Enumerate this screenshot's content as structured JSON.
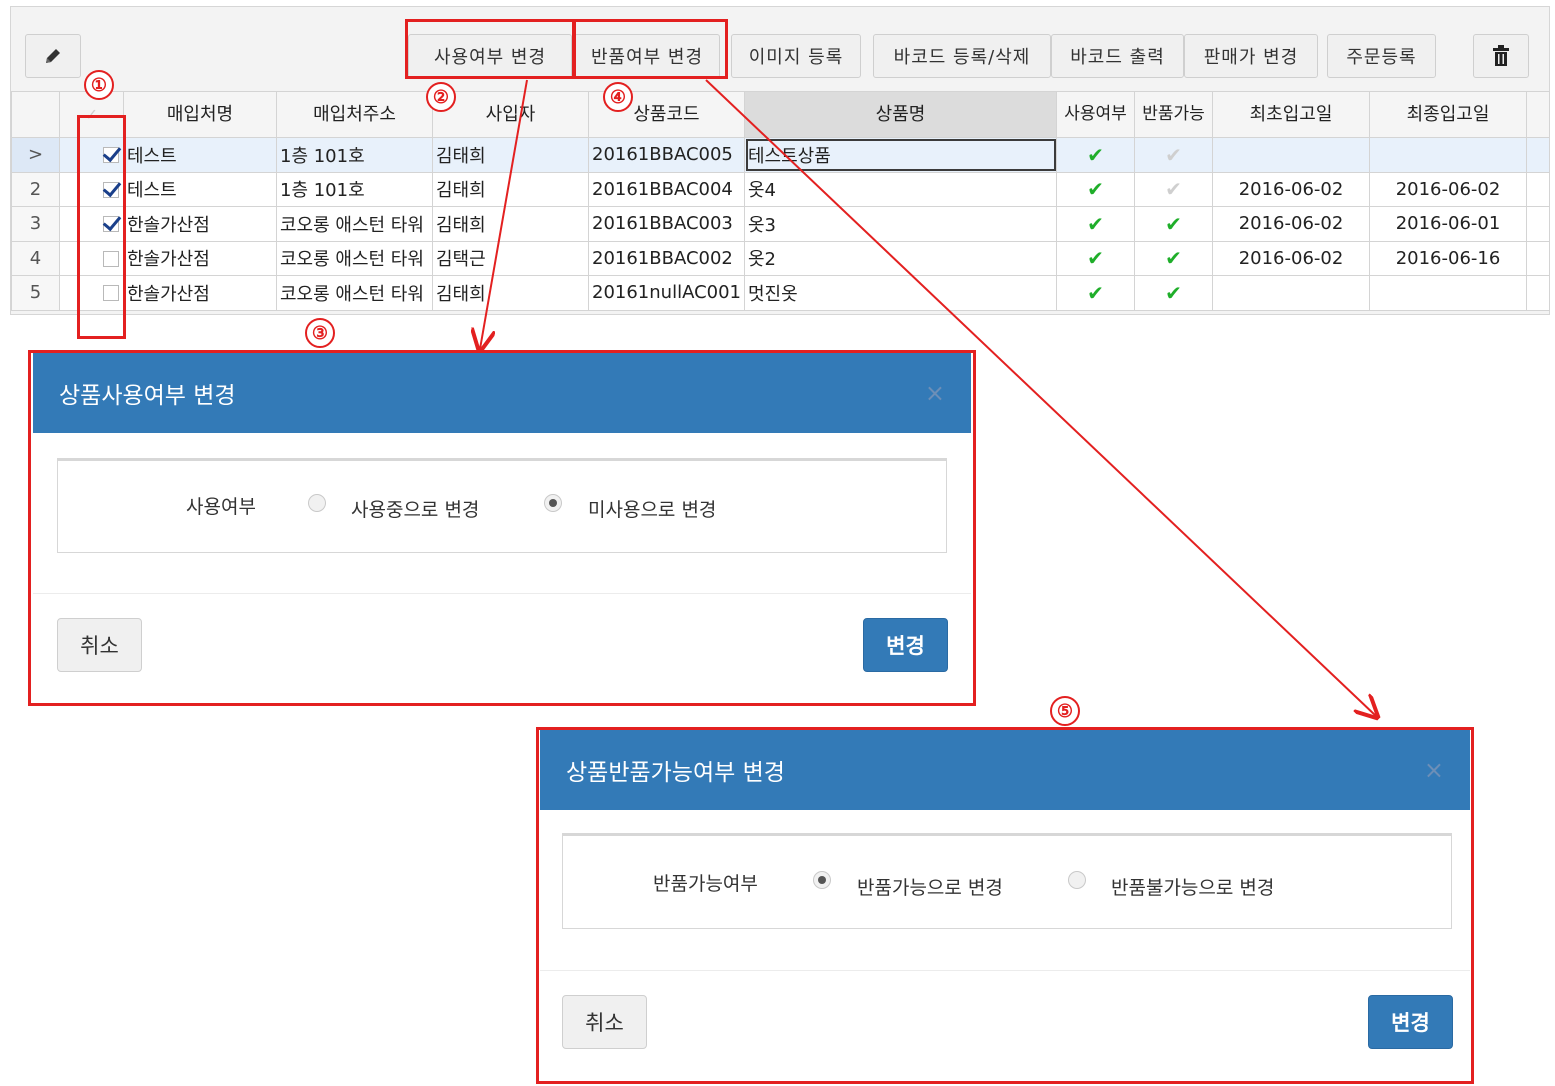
{
  "toolbar": {
    "edit_icon": "pencil-icon",
    "buttons": [
      "사용여부 변경",
      "반품여부 변경",
      "이미지 등록",
      "바코드 등록/삭제",
      "바코드 출력",
      "판매가 변경",
      "주문등록"
    ],
    "delete_icon": "trash-icon"
  },
  "grid": {
    "headers": [
      "매입처명",
      "매입처주소",
      "사입자",
      "상품코드",
      "상품명",
      "사용여부",
      "반품가능",
      "최초입고일",
      "최종입고일"
    ],
    "rows": [
      {
        "num": ">",
        "checked": true,
        "vendor": "테스트",
        "address": "1층 101호",
        "buyer": "김태희",
        "code": "20161BBAC005",
        "name": "테스트상품",
        "use": true,
        "return": false,
        "first": "",
        "last": ""
      },
      {
        "num": "2",
        "checked": true,
        "vendor": "테스트",
        "address": "1층 101호",
        "buyer": "김태희",
        "code": "20161BBAC004",
        "name": "옷4",
        "use": true,
        "return": false,
        "first": "2016-06-02",
        "last": "2016-06-02"
      },
      {
        "num": "3",
        "checked": true,
        "vendor": "한솔가산점",
        "address": "코오롱 애스턴 타워",
        "buyer": "김태희",
        "code": "20161BBAC003",
        "name": "옷3",
        "use": true,
        "return": true,
        "first": "2016-06-02",
        "last": "2016-06-01"
      },
      {
        "num": "4",
        "checked": false,
        "vendor": "한솔가산점",
        "address": "코오롱 애스턴 타워",
        "buyer": "김택근",
        "code": "20161BBAC002",
        "name": "옷2",
        "use": true,
        "return": true,
        "first": "2016-06-02",
        "last": "2016-06-16"
      },
      {
        "num": "5",
        "checked": false,
        "vendor": "한솔가산점",
        "address": "코오롱 애스턴 타워",
        "buyer": "김태희",
        "code": "20161nullAC001",
        "name": "멋진옷",
        "use": true,
        "return": true,
        "first": "",
        "last": ""
      }
    ]
  },
  "markers": [
    "①",
    "②",
    "③",
    "④",
    "⑤"
  ],
  "dialog_use": {
    "title": "상품사용여부 변경",
    "field_label": "사용여부",
    "option_1": "사용중으로 변경",
    "option_2": "미사용으로 변경",
    "selected": 2,
    "cancel": "취소",
    "confirm": "변경"
  },
  "dialog_return": {
    "title": "상품반품가능여부 변경",
    "field_label": "반품가능여부",
    "option_1": "반품가능으로 변경",
    "option_2": "반품불가능으로 변경",
    "selected": 1,
    "cancel": "취소",
    "confirm": "변경"
  },
  "colors": {
    "accent": "#337ab7",
    "annotation": "#e32020",
    "check": "#1fae2a"
  }
}
